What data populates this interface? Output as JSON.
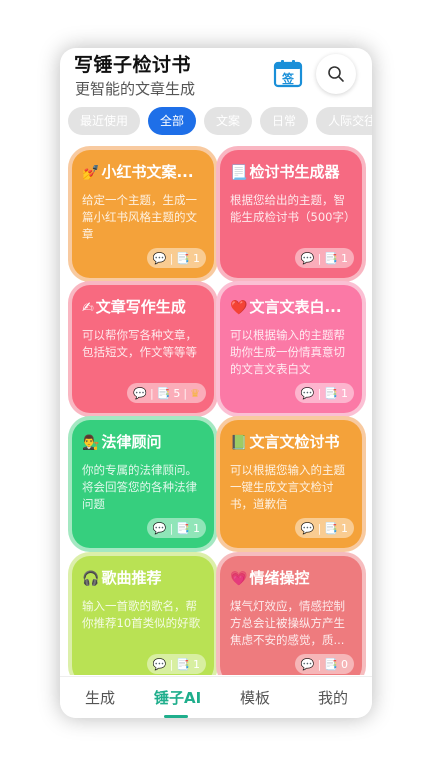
{
  "header": {
    "title": "写锤子检讨书",
    "subtitle": "更智能的文章生成",
    "sign_label": "签"
  },
  "chips": [
    {
      "label": "最近使用",
      "active": false
    },
    {
      "label": "全部",
      "active": true
    },
    {
      "label": "文案",
      "active": false
    },
    {
      "label": "日常",
      "active": false
    },
    {
      "label": "人际交往",
      "active": false
    }
  ],
  "cards": [
    {
      "emoji": "💅",
      "title": "小红书文案...",
      "desc": "给定一个主题，生成一篇小红书风格主题的文章",
      "count": "1",
      "color": "#f4a23a",
      "ring": "#f8caa0"
    },
    {
      "emoji": "📃",
      "title": "检讨书生成器",
      "desc": "根据您给出的主题，智能生成检讨书（500字）",
      "count": "1",
      "color": "#f66a82",
      "ring": "#f9b6c2"
    },
    {
      "emoji": "✍",
      "title": "文章写作生成",
      "desc": "可以帮你写各种文章，包括短文，作文等等等",
      "count": "5",
      "color": "#f86a80",
      "ring": "#f9b7c2"
    },
    {
      "emoji": "❤️",
      "title": "文言文表白...",
      "desc": "可以根据输入的主题帮助你生成一份情真意切的文言文表白文",
      "count": "1",
      "color": "#fb79a6",
      "ring": "#fbc0d4"
    },
    {
      "emoji": "👨‍⚖️",
      "title": "法律顾问",
      "desc": "你的专属的法律顾问。将会回答您的各种法律问题",
      "count": "1",
      "color": "#36cf7e",
      "ring": "#a4e8c2"
    },
    {
      "emoji": "📗",
      "title": "文言文检讨书",
      "desc": "可以根据您输入的主题一键生成文言文检讨书，道歉信",
      "count": "1",
      "color": "#f4a23a",
      "ring": "#f8caa0"
    },
    {
      "emoji": "🎧",
      "title": "歌曲推荐",
      "desc": "输入一首歌的歌名，帮你推荐10首类似的好歌",
      "count": "1",
      "color": "#b9e254",
      "ring": "#dcefaa"
    },
    {
      "emoji": "💗",
      "title": "情绪操控",
      "desc": "煤气灯效应，情感控制方总会让被操纵方产生焦虑不安的感觉，质...",
      "count": "0",
      "color": "#ee7b7e",
      "ring": "#f6bcbe"
    }
  ],
  "nav": [
    {
      "label": "生成",
      "active": false
    },
    {
      "label": "锤子AI",
      "active": true
    },
    {
      "label": "模板",
      "active": false
    },
    {
      "label": "我的",
      "active": false
    }
  ]
}
